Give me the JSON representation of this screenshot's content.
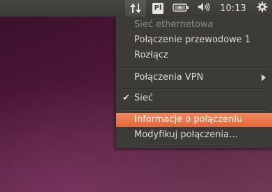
{
  "panel": {
    "network_icon": "network-updown-icon",
    "keyboard_layout": "Pl",
    "battery_icon": "battery-charging-icon",
    "volume_icon": "volume-icon",
    "clock": "10:13",
    "system_icon": "gear-icon"
  },
  "menu": {
    "header": "Sieć ethernetowa",
    "wired_connection": "Połączenie przewodowe 1",
    "disconnect": "Rozłącz",
    "vpn": "Połączenia VPN",
    "network": "Sieć",
    "network_enabled_mark": "✔",
    "connection_info": "Informacje o połączeniu",
    "edit_connections": "Modyfikuj połączenia..."
  },
  "colors": {
    "highlight": "#e6653a",
    "panel": "#3c3b37",
    "menu_text": "#dfdbd2",
    "header_text": "#8b8a85"
  }
}
